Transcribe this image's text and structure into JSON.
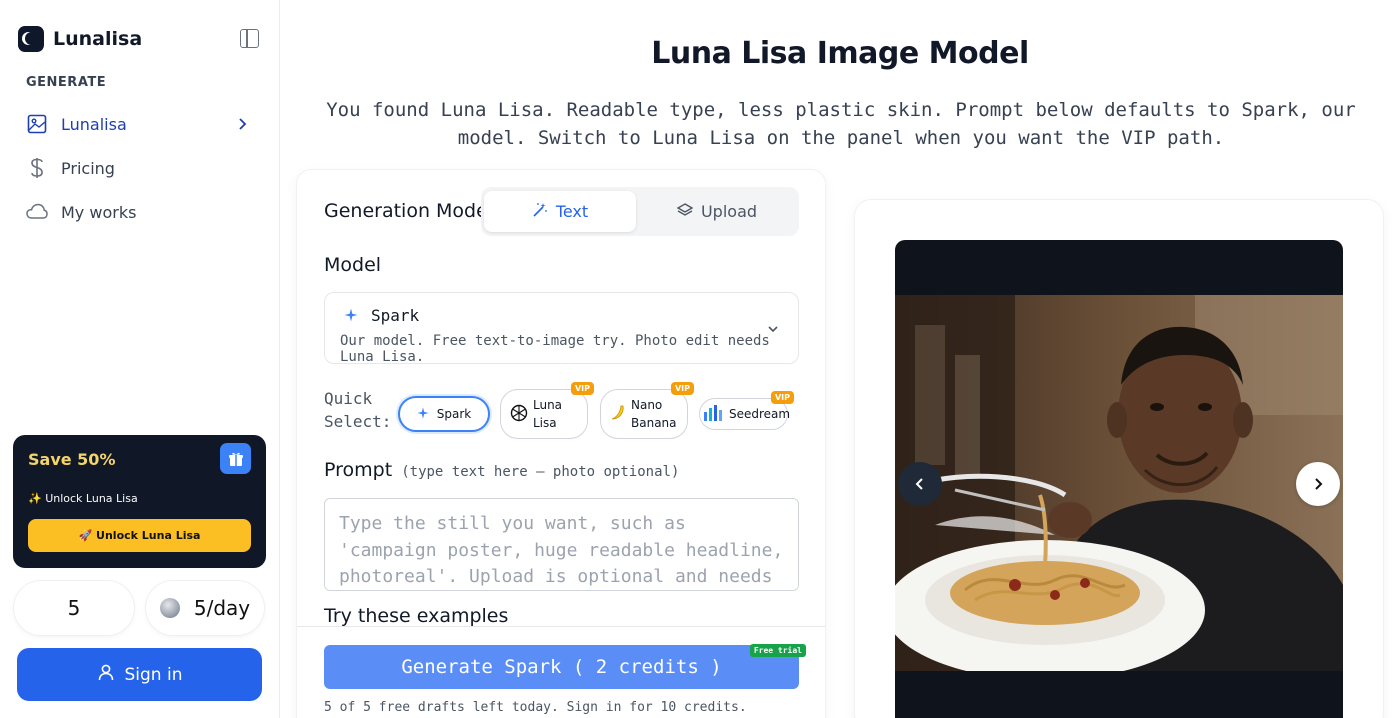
{
  "brand": {
    "name": "Lunalisa"
  },
  "sidebar": {
    "section": "GENERATE",
    "items": [
      {
        "label": "Lunalisa",
        "icon": "image-icon",
        "active": true
      },
      {
        "label": "Pricing",
        "icon": "dollar-icon",
        "active": false
      },
      {
        "label": "My works",
        "icon": "cloud-icon",
        "active": false
      }
    ]
  },
  "promo": {
    "title": "Save 50%",
    "line": "✨ Unlock Luna Lisa",
    "button": "🚀 Unlock Luna Lisa"
  },
  "stats": {
    "credits": "5",
    "daily": "5/day"
  },
  "signin": {
    "label": "Sign in"
  },
  "header": {
    "title": "Luna Lisa Image Model",
    "subtitle": "You found Luna Lisa. Readable type, less plastic skin. Prompt below defaults to Spark, our model. Switch to Luna Lisa on the panel when you want the VIP path."
  },
  "generator": {
    "mode_label": "Generation Mode",
    "modes": [
      {
        "label": "Text",
        "active": true
      },
      {
        "label": "Upload",
        "active": false
      }
    ],
    "model_label": "Model",
    "model": {
      "name": "Spark",
      "description": "Our model. Free text-to-image try. Photo edit needs Luna Lisa."
    },
    "quick_label_1": "Quick",
    "quick_label_2": "Select:",
    "quick": [
      {
        "line1": "Spark",
        "line2": "",
        "vip": false
      },
      {
        "line1": "Luna",
        "line2": "Lisa",
        "vip": true
      },
      {
        "line1": "Nano",
        "line2": "Banana",
        "vip": true
      },
      {
        "line1": "Seedream",
        "line2": "",
        "vip": true
      }
    ],
    "vip_text": "VIP",
    "prompt_label": "Prompt",
    "prompt_hint": "(type text here — photo optional)",
    "prompt_placeholder": "Type the still you want, such as 'campaign poster, huge readable headline, photoreal'. Upload is optional and needs Luna Lisa.",
    "examples_label": "Try these examples",
    "generate_button": "Generate Spark ( 2 credits )",
    "free_badge": "Free trial",
    "footnote": "5 of 5 free drafts left today. Sign in for 10 credits."
  },
  "colors": {
    "accent": "#2563eb",
    "vip": "#f59e0b",
    "promo_bg": "#101827",
    "promo_btn": "#fbbf24"
  }
}
